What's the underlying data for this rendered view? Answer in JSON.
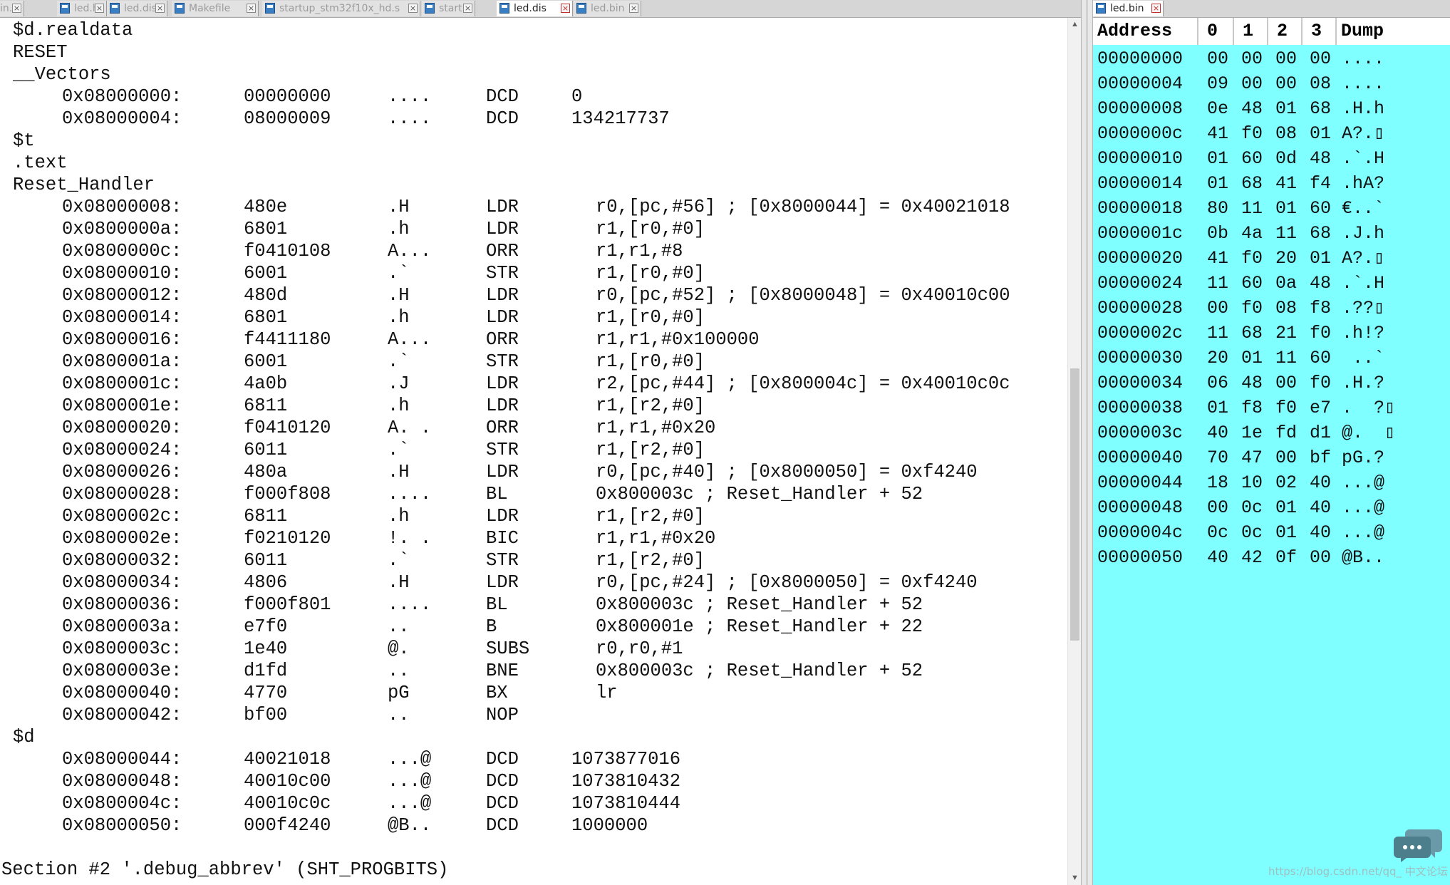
{
  "left_tabs": [
    {
      "label": "in.c",
      "active": false
    },
    {
      "label": "led.h",
      "active": false
    },
    {
      "label": "led.dis",
      "active": false
    },
    {
      "label": "Makefile",
      "active": false
    },
    {
      "label": "startup_stm32f10x_hd.s",
      "active": false
    },
    {
      "label": "start.s",
      "active": false
    },
    {
      "label": "led.dis",
      "active": true
    },
    {
      "label": "led.bin",
      "active": false
    }
  ],
  "right_tabs": [
    {
      "label": "led.bin",
      "active": true
    }
  ],
  "close_glyph": "×",
  "disassembly": [
    {
      "t": "label",
      "text": "$d.realdata"
    },
    {
      "t": "label",
      "text": "RESET"
    },
    {
      "t": "label",
      "text": "__Vectors"
    },
    {
      "t": "data",
      "addr": "0x08000000:",
      "hex": "00000000",
      "ascii": "....",
      "op": "DCD",
      "args": "0"
    },
    {
      "t": "data",
      "addr": "0x08000004:",
      "hex": "08000009",
      "ascii": "....",
      "op": "DCD",
      "args": "134217737"
    },
    {
      "t": "label",
      "text": "$t"
    },
    {
      "t": "label",
      "text": ".text"
    },
    {
      "t": "label",
      "text": "Reset_Handler"
    },
    {
      "t": "ins",
      "addr": "0x08000008:",
      "hex": "480e",
      "ascii": ".H",
      "op": "LDR",
      "args": "r0,[pc,#56] ; [0x8000044] = 0x40021018"
    },
    {
      "t": "ins",
      "addr": "0x0800000a:",
      "hex": "6801",
      "ascii": ".h",
      "op": "LDR",
      "args": "r1,[r0,#0]"
    },
    {
      "t": "ins",
      "addr": "0x0800000c:",
      "hex": "f0410108",
      "ascii": "A...",
      "op": "ORR",
      "args": "r1,r1,#8"
    },
    {
      "t": "ins",
      "addr": "0x08000010:",
      "hex": "6001",
      "ascii": ".`",
      "op": "STR",
      "args": "r1,[r0,#0]"
    },
    {
      "t": "ins",
      "addr": "0x08000012:",
      "hex": "480d",
      "ascii": ".H",
      "op": "LDR",
      "args": "r0,[pc,#52] ; [0x8000048] = 0x40010c00"
    },
    {
      "t": "ins",
      "addr": "0x08000014:",
      "hex": "6801",
      "ascii": ".h",
      "op": "LDR",
      "args": "r1,[r0,#0]"
    },
    {
      "t": "ins",
      "addr": "0x08000016:",
      "hex": "f4411180",
      "ascii": "A...",
      "op": "ORR",
      "args": "r1,r1,#0x100000"
    },
    {
      "t": "ins",
      "addr": "0x0800001a:",
      "hex": "6001",
      "ascii": ".`",
      "op": "STR",
      "args": "r1,[r0,#0]"
    },
    {
      "t": "ins",
      "addr": "0x0800001c:",
      "hex": "4a0b",
      "ascii": ".J",
      "op": "LDR",
      "args": "r2,[pc,#44] ; [0x800004c] = 0x40010c0c"
    },
    {
      "t": "ins",
      "addr": "0x0800001e:",
      "hex": "6811",
      "ascii": ".h",
      "op": "LDR",
      "args": "r1,[r2,#0]"
    },
    {
      "t": "ins",
      "addr": "0x08000020:",
      "hex": "f0410120",
      "ascii": "A. .",
      "op": "ORR",
      "args": "r1,r1,#0x20"
    },
    {
      "t": "ins",
      "addr": "0x08000024:",
      "hex": "6011",
      "ascii": ".`",
      "op": "STR",
      "args": "r1,[r2,#0]"
    },
    {
      "t": "ins",
      "addr": "0x08000026:",
      "hex": "480a",
      "ascii": ".H",
      "op": "LDR",
      "args": "r0,[pc,#40] ; [0x8000050] = 0xf4240"
    },
    {
      "t": "ins",
      "addr": "0x08000028:",
      "hex": "f000f808",
      "ascii": "....",
      "op": "BL",
      "args": "0x800003c ; Reset_Handler + 52"
    },
    {
      "t": "ins",
      "addr": "0x0800002c:",
      "hex": "6811",
      "ascii": ".h",
      "op": "LDR",
      "args": "r1,[r2,#0]"
    },
    {
      "t": "ins",
      "addr": "0x0800002e:",
      "hex": "f0210120",
      "ascii": "!. .",
      "op": "BIC",
      "args": "r1,r1,#0x20"
    },
    {
      "t": "ins",
      "addr": "0x08000032:",
      "hex": "6011",
      "ascii": ".`",
      "op": "STR",
      "args": "r1,[r2,#0]"
    },
    {
      "t": "ins",
      "addr": "0x08000034:",
      "hex": "4806",
      "ascii": ".H",
      "op": "LDR",
      "args": "r0,[pc,#24] ; [0x8000050] = 0xf4240"
    },
    {
      "t": "ins",
      "addr": "0x08000036:",
      "hex": "f000f801",
      "ascii": "....",
      "op": "BL",
      "args": "0x800003c ; Reset_Handler + 52"
    },
    {
      "t": "ins",
      "addr": "0x0800003a:",
      "hex": "e7f0",
      "ascii": "..",
      "op": "B",
      "args": "0x800001e ; Reset_Handler + 22"
    },
    {
      "t": "ins",
      "addr": "0x0800003c:",
      "hex": "1e40",
      "ascii": "@.",
      "op": "SUBS",
      "args": "r0,r0,#1"
    },
    {
      "t": "ins",
      "addr": "0x0800003e:",
      "hex": "d1fd",
      "ascii": "..",
      "op": "BNE",
      "args": "0x800003c ; Reset_Handler + 52"
    },
    {
      "t": "ins",
      "addr": "0x08000040:",
      "hex": "4770",
      "ascii": "pG",
      "op": "BX",
      "args": "lr"
    },
    {
      "t": "ins",
      "addr": "0x08000042:",
      "hex": "bf00",
      "ascii": "..",
      "op": "NOP",
      "args": ""
    },
    {
      "t": "label",
      "text": "$d"
    },
    {
      "t": "data",
      "addr": "0x08000044:",
      "hex": "40021018",
      "ascii": "...@",
      "op": "DCD",
      "args": "1073877016"
    },
    {
      "t": "data",
      "addr": "0x08000048:",
      "hex": "40010c00",
      "ascii": "...@",
      "op": "DCD",
      "args": "1073810432"
    },
    {
      "t": "data",
      "addr": "0x0800004c:",
      "hex": "40010c0c",
      "ascii": "...@",
      "op": "DCD",
      "args": "1073810444"
    },
    {
      "t": "data",
      "addr": "0x08000050:",
      "hex": "000f4240",
      "ascii": "@B..",
      "op": "DCD",
      "args": "1000000"
    },
    {
      "t": "blank",
      "text": ""
    },
    {
      "t": "section",
      "text": "Section #2 '.debug_abbrev' (SHT_PROGBITS)"
    }
  ],
  "hex_view": {
    "headers": [
      "Address",
      "0",
      "1",
      "2",
      "3",
      "Dump"
    ],
    "rows": [
      {
        "addr": "00000000",
        "bytes": [
          "00",
          "00",
          "00",
          "00"
        ],
        "dump": "...."
      },
      {
        "addr": "00000004",
        "bytes": [
          "09",
          "00",
          "00",
          "08"
        ],
        "dump": "...."
      },
      {
        "addr": "00000008",
        "bytes": [
          "0e",
          "48",
          "01",
          "68"
        ],
        "dump": ".H.h"
      },
      {
        "addr": "0000000c",
        "bytes": [
          "41",
          "f0",
          "08",
          "01"
        ],
        "dump": "A?.▯"
      },
      {
        "addr": "00000010",
        "bytes": [
          "01",
          "60",
          "0d",
          "48"
        ],
        "dump": ".`.H"
      },
      {
        "addr": "00000014",
        "bytes": [
          "01",
          "68",
          "41",
          "f4"
        ],
        "dump": ".hA?"
      },
      {
        "addr": "00000018",
        "bytes": [
          "80",
          "11",
          "01",
          "60"
        ],
        "dump": "€..`"
      },
      {
        "addr": "0000001c",
        "bytes": [
          "0b",
          "4a",
          "11",
          "68"
        ],
        "dump": ".J.h"
      },
      {
        "addr": "00000020",
        "bytes": [
          "41",
          "f0",
          "20",
          "01"
        ],
        "dump": "A?.▯"
      },
      {
        "addr": "00000024",
        "bytes": [
          "11",
          "60",
          "0a",
          "48"
        ],
        "dump": ".`.H"
      },
      {
        "addr": "00000028",
        "bytes": [
          "00",
          "f0",
          "08",
          "f8"
        ],
        "dump": ".??▯"
      },
      {
        "addr": "0000002c",
        "bytes": [
          "11",
          "68",
          "21",
          "f0"
        ],
        "dump": ".h!?"
      },
      {
        "addr": "00000030",
        "bytes": [
          "20",
          "01",
          "11",
          "60"
        ],
        "dump": " ..`"
      },
      {
        "addr": "00000034",
        "bytes": [
          "06",
          "48",
          "00",
          "f0"
        ],
        "dump": ".H.?"
      },
      {
        "addr": "00000038",
        "bytes": [
          "01",
          "f8",
          "f0",
          "e7"
        ],
        "dump": ".  ?▯"
      },
      {
        "addr": "0000003c",
        "bytes": [
          "40",
          "1e",
          "fd",
          "d1"
        ],
        "dump": "@.  ▯"
      },
      {
        "addr": "00000040",
        "bytes": [
          "70",
          "47",
          "00",
          "bf"
        ],
        "dump": "pG.?"
      },
      {
        "addr": "00000044",
        "bytes": [
          "18",
          "10",
          "02",
          "40"
        ],
        "dump": "...@"
      },
      {
        "addr": "00000048",
        "bytes": [
          "00",
          "0c",
          "01",
          "40"
        ],
        "dump": "...@"
      },
      {
        "addr": "0000004c",
        "bytes": [
          "0c",
          "0c",
          "01",
          "40"
        ],
        "dump": "...@"
      },
      {
        "addr": "00000050",
        "bytes": [
          "40",
          "42",
          "0f",
          "00"
        ],
        "dump": "@B.."
      }
    ]
  },
  "watermark": "https://blog.csdn.net/qq_",
  "chat_icon_caption": "中文论坛",
  "colors": {
    "hex_background": "#7fffff",
    "editor_background": "#ffffff",
    "tab_file_icon": "#3a7fc4"
  },
  "icons": [
    "file-icon",
    "close-icon",
    "scroll-up-arrow-icon",
    "scroll-down-arrow-icon",
    "chat-bubble-icon"
  ]
}
